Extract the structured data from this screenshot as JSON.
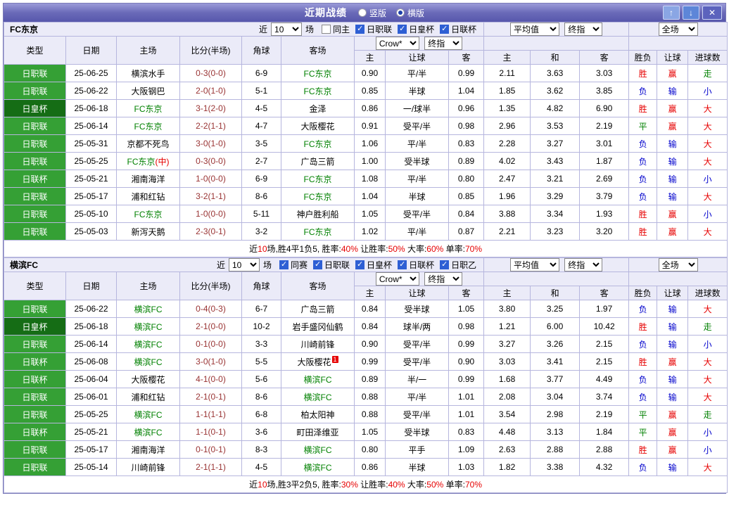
{
  "titlebar": {
    "title": "近期战绩",
    "radios": [
      {
        "label": "竖版",
        "selected": false
      },
      {
        "label": "横版",
        "selected": true
      }
    ],
    "buttons": {
      "up": "↑",
      "down": "↓",
      "close": "✕"
    }
  },
  "colors": {
    "league_default": "#35a035",
    "league_colors": {
      "日职联": "#35a035",
      "日联杯": "#35a035",
      "日皇杯": "#156d15",
      "日职乙": "#35a035"
    },
    "self_team": "#008000",
    "score": "#993333",
    "summary_red": "#e60000",
    "results": {
      "w": "#e60000",
      "l": "#0000cc",
      "d": "#008000"
    }
  },
  "header": {
    "filter_prefix": "近",
    "filter_suffix": "场",
    "main_cols": [
      "类型",
      "日期",
      "主场",
      "比分(半场)",
      "角球",
      "客场"
    ],
    "odds_selects": [
      "Crow*",
      "终指"
    ],
    "avg_selects": [
      "平均值",
      "终指"
    ],
    "scope_select": "全场",
    "sub_cols": [
      "主",
      "让球",
      "客",
      "主",
      "和",
      "客",
      "胜负",
      "让球",
      "进球数"
    ]
  },
  "sections": [
    {
      "team": "FC东京",
      "games_count": "10",
      "checkboxes": [
        {
          "label": "同主",
          "checked": false
        },
        {
          "label": "日职联",
          "checked": true
        },
        {
          "label": "日皇杯",
          "checked": true
        },
        {
          "label": "日联杯",
          "checked": true
        }
      ],
      "rows": [
        {
          "type": "日职联",
          "date": "25-06-25",
          "home": "横滨水手",
          "home_self": false,
          "score": "0-3(0-0)",
          "corner": "6-9",
          "away": "FC东京",
          "away_self": true,
          "odds": [
            "0.90",
            "平/半",
            "0.99"
          ],
          "avg": [
            "2.11",
            "3.63",
            "3.03"
          ],
          "results": [
            [
              "胜",
              "w"
            ],
            [
              "赢",
              "w"
            ],
            [
              "走",
              "d"
            ]
          ]
        },
        {
          "type": "日职联",
          "date": "25-06-22",
          "home": "大阪钢巴",
          "home_self": false,
          "score": "2-0(1-0)",
          "corner": "5-1",
          "away": "FC东京",
          "away_self": true,
          "odds": [
            "0.85",
            "半球",
            "1.04"
          ],
          "avg": [
            "1.85",
            "3.62",
            "3.85"
          ],
          "results": [
            [
              "负",
              "l"
            ],
            [
              "输",
              "l"
            ],
            [
              "小",
              "l"
            ]
          ]
        },
        {
          "type": "日皇杯",
          "date": "25-06-18",
          "home": "FC东京",
          "home_self": true,
          "score": "3-1(2-0)",
          "corner": "4-5",
          "away": "金泽",
          "away_self": false,
          "odds": [
            "0.86",
            "一/球半",
            "0.96"
          ],
          "avg": [
            "1.35",
            "4.82",
            "6.90"
          ],
          "results": [
            [
              "胜",
              "w"
            ],
            [
              "赢",
              "w"
            ],
            [
              "大",
              "w"
            ]
          ]
        },
        {
          "type": "日职联",
          "date": "25-06-14",
          "home": "FC东京",
          "home_self": true,
          "score": "2-2(1-1)",
          "corner": "4-7",
          "away": "大阪樱花",
          "away_self": false,
          "odds": [
            "0.91",
            "受平/半",
            "0.98"
          ],
          "avg": [
            "2.96",
            "3.53",
            "2.19"
          ],
          "results": [
            [
              "平",
              "d"
            ],
            [
              "赢",
              "w"
            ],
            [
              "大",
              "w"
            ]
          ]
        },
        {
          "type": "日职联",
          "date": "25-05-31",
          "home": "京都不死鸟",
          "home_self": false,
          "score": "3-0(1-0)",
          "corner": "3-5",
          "away": "FC东京",
          "away_self": true,
          "odds": [
            "1.06",
            "平/半",
            "0.83"
          ],
          "avg": [
            "2.28",
            "3.27",
            "3.01"
          ],
          "results": [
            [
              "负",
              "l"
            ],
            [
              "输",
              "l"
            ],
            [
              "大",
              "w"
            ]
          ]
        },
        {
          "type": "日职联",
          "date": "25-05-25",
          "home": "FC东京",
          "home_self": true,
          "home_note": "(中)",
          "score": "0-3(0-0)",
          "corner": "2-7",
          "away": "广岛三箭",
          "away_self": false,
          "odds": [
            "1.00",
            "受半球",
            "0.89"
          ],
          "avg": [
            "4.02",
            "3.43",
            "1.87"
          ],
          "results": [
            [
              "负",
              "l"
            ],
            [
              "输",
              "l"
            ],
            [
              "大",
              "w"
            ]
          ]
        },
        {
          "type": "日联杯",
          "date": "25-05-21",
          "home": "湘南海洋",
          "home_self": false,
          "score": "1-0(0-0)",
          "corner": "6-9",
          "away": "FC东京",
          "away_self": true,
          "odds": [
            "1.08",
            "平/半",
            "0.80"
          ],
          "avg": [
            "2.47",
            "3.21",
            "2.69"
          ],
          "results": [
            [
              "负",
              "l"
            ],
            [
              "输",
              "l"
            ],
            [
              "小",
              "l"
            ]
          ]
        },
        {
          "type": "日职联",
          "date": "25-05-17",
          "home": "浦和红钻",
          "home_self": false,
          "score": "3-2(1-1)",
          "corner": "8-6",
          "away": "FC东京",
          "away_self": true,
          "odds": [
            "1.04",
            "半球",
            "0.85"
          ],
          "avg": [
            "1.96",
            "3.29",
            "3.79"
          ],
          "results": [
            [
              "负",
              "l"
            ],
            [
              "输",
              "l"
            ],
            [
              "大",
              "w"
            ]
          ]
        },
        {
          "type": "日职联",
          "date": "25-05-10",
          "home": "FC东京",
          "home_self": true,
          "score": "1-0(0-0)",
          "corner": "5-11",
          "away": "神户胜利船",
          "away_self": false,
          "odds": [
            "1.05",
            "受平/半",
            "0.84"
          ],
          "avg": [
            "3.88",
            "3.34",
            "1.93"
          ],
          "results": [
            [
              "胜",
              "w"
            ],
            [
              "赢",
              "w"
            ],
            [
              "小",
              "l"
            ]
          ]
        },
        {
          "type": "日职联",
          "date": "25-05-03",
          "home": "新泻天鹅",
          "home_self": false,
          "score": "2-3(0-1)",
          "corner": "3-2",
          "away": "FC东京",
          "away_self": true,
          "odds": [
            "1.02",
            "平/半",
            "0.87"
          ],
          "avg": [
            "2.21",
            "3.23",
            "3.20"
          ],
          "results": [
            [
              "胜",
              "w"
            ],
            [
              "赢",
              "w"
            ],
            [
              "大",
              "w"
            ]
          ]
        }
      ],
      "summary": [
        {
          "t": "近",
          "c": "k"
        },
        {
          "t": "10",
          "c": "r"
        },
        {
          "t": "场,胜4平1负5, 胜率:",
          "c": "k"
        },
        {
          "t": "40%",
          "c": "r"
        },
        {
          "t": "  让胜率:",
          "c": "k"
        },
        {
          "t": "50%",
          "c": "r"
        },
        {
          "t": "  大率:",
          "c": "k"
        },
        {
          "t": "60%",
          "c": "r"
        },
        {
          "t": "  单率:",
          "c": "k"
        },
        {
          "t": "70%",
          "c": "r"
        }
      ]
    },
    {
      "team": "横滨FC",
      "games_count": "10",
      "checkboxes": [
        {
          "label": "同赛",
          "checked": true
        },
        {
          "label": "日职联",
          "checked": true
        },
        {
          "label": "日皇杯",
          "checked": true
        },
        {
          "label": "日联杯",
          "checked": true
        },
        {
          "label": "日职乙",
          "checked": true
        }
      ],
      "rows": [
        {
          "type": "日职联",
          "date": "25-06-22",
          "home": "横滨FC",
          "home_self": true,
          "score": "0-4(0-3)",
          "corner": "6-7",
          "away": "广岛三箭",
          "away_self": false,
          "odds": [
            "0.84",
            "受半球",
            "1.05"
          ],
          "avg": [
            "3.80",
            "3.25",
            "1.97"
          ],
          "results": [
            [
              "负",
              "l"
            ],
            [
              "输",
              "l"
            ],
            [
              "大",
              "w"
            ]
          ]
        },
        {
          "type": "日皇杯",
          "date": "25-06-18",
          "home": "横滨FC",
          "home_self": true,
          "score": "2-1(0-0)",
          "corner": "10-2",
          "away": "岩手盛冈仙鹤",
          "away_self": false,
          "odds": [
            "0.84",
            "球半/两",
            "0.98"
          ],
          "avg": [
            "1.21",
            "6.00",
            "10.42"
          ],
          "results": [
            [
              "胜",
              "w"
            ],
            [
              "输",
              "l"
            ],
            [
              "走",
              "d"
            ]
          ]
        },
        {
          "type": "日职联",
          "date": "25-06-14",
          "home": "横滨FC",
          "home_self": true,
          "score": "0-1(0-0)",
          "corner": "3-3",
          "away": "川崎前锋",
          "away_self": false,
          "odds": [
            "0.90",
            "受平/半",
            "0.99"
          ],
          "avg": [
            "3.27",
            "3.26",
            "2.15"
          ],
          "results": [
            [
              "负",
              "l"
            ],
            [
              "输",
              "l"
            ],
            [
              "小",
              "l"
            ]
          ]
        },
        {
          "type": "日联杯",
          "date": "25-06-08",
          "home": "横滨FC",
          "home_self": true,
          "score": "3-0(1-0)",
          "corner": "5-5",
          "away": "大阪樱花",
          "away_self": false,
          "away_note": "1",
          "odds": [
            "0.99",
            "受平/半",
            "0.90"
          ],
          "avg": [
            "3.03",
            "3.41",
            "2.15"
          ],
          "results": [
            [
              "胜",
              "w"
            ],
            [
              "赢",
              "w"
            ],
            [
              "大",
              "w"
            ]
          ]
        },
        {
          "type": "日联杯",
          "date": "25-06-04",
          "home": "大阪樱花",
          "home_self": false,
          "score": "4-1(0-0)",
          "corner": "5-6",
          "away": "横滨FC",
          "away_self": true,
          "odds": [
            "0.89",
            "半/一",
            "0.99"
          ],
          "avg": [
            "1.68",
            "3.77",
            "4.49"
          ],
          "results": [
            [
              "负",
              "l"
            ],
            [
              "输",
              "l"
            ],
            [
              "大",
              "w"
            ]
          ]
        },
        {
          "type": "日职联",
          "date": "25-06-01",
          "home": "浦和红钻",
          "home_self": false,
          "score": "2-1(0-1)",
          "corner": "8-6",
          "away": "横滨FC",
          "away_self": true,
          "odds": [
            "0.88",
            "平/半",
            "1.01"
          ],
          "avg": [
            "2.08",
            "3.04",
            "3.74"
          ],
          "results": [
            [
              "负",
              "l"
            ],
            [
              "输",
              "l"
            ],
            [
              "大",
              "w"
            ]
          ]
        },
        {
          "type": "日职联",
          "date": "25-05-25",
          "home": "横滨FC",
          "home_self": true,
          "score": "1-1(1-1)",
          "corner": "6-8",
          "away": "柏太阳神",
          "away_self": false,
          "odds": [
            "0.88",
            "受平/半",
            "1.01"
          ],
          "avg": [
            "3.54",
            "2.98",
            "2.19"
          ],
          "results": [
            [
              "平",
              "d"
            ],
            [
              "赢",
              "w"
            ],
            [
              "走",
              "d"
            ]
          ]
        },
        {
          "type": "日联杯",
          "date": "25-05-21",
          "home": "横滨FC",
          "home_self": true,
          "score": "1-1(0-1)",
          "corner": "3-6",
          "away": "町田泽维亚",
          "away_self": false,
          "odds": [
            "1.05",
            "受半球",
            "0.83"
          ],
          "avg": [
            "4.48",
            "3.13",
            "1.84"
          ],
          "results": [
            [
              "平",
              "d"
            ],
            [
              "赢",
              "w"
            ],
            [
              "小",
              "l"
            ]
          ]
        },
        {
          "type": "日职联",
          "date": "25-05-17",
          "home": "湘南海洋",
          "home_self": false,
          "score": "0-1(0-1)",
          "corner": "8-3",
          "away": "横滨FC",
          "away_self": true,
          "odds": [
            "0.80",
            "平手",
            "1.09"
          ],
          "avg": [
            "2.63",
            "2.88",
            "2.88"
          ],
          "results": [
            [
              "胜",
              "w"
            ],
            [
              "赢",
              "w"
            ],
            [
              "小",
              "l"
            ]
          ]
        },
        {
          "type": "日职联",
          "date": "25-05-14",
          "home": "川崎前锋",
          "home_self": false,
          "score": "2-1(1-1)",
          "corner": "4-5",
          "away": "横滨FC",
          "away_self": true,
          "odds": [
            "0.86",
            "半球",
            "1.03"
          ],
          "avg": [
            "1.82",
            "3.38",
            "4.32"
          ],
          "results": [
            [
              "负",
              "l"
            ],
            [
              "输",
              "l"
            ],
            [
              "大",
              "w"
            ]
          ]
        }
      ],
      "summary": [
        {
          "t": "近",
          "c": "k"
        },
        {
          "t": "10",
          "c": "r"
        },
        {
          "t": "场,胜3平2负5, 胜率:",
          "c": "k"
        },
        {
          "t": "30%",
          "c": "r"
        },
        {
          "t": "  让胜率:",
          "c": "k"
        },
        {
          "t": "40%",
          "c": "r"
        },
        {
          "t": "  大率:",
          "c": "k"
        },
        {
          "t": "50%",
          "c": "r"
        },
        {
          "t": "  单率:",
          "c": "k"
        },
        {
          "t": "70%",
          "c": "r"
        }
      ]
    }
  ]
}
